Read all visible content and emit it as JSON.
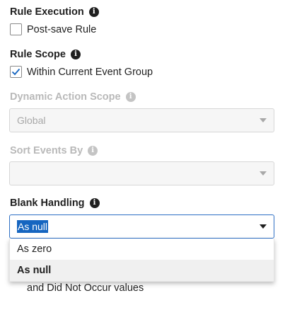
{
  "rule_execution": {
    "title": "Rule Execution",
    "post_save_label": "Post-save Rule",
    "post_save_checked": false
  },
  "rule_scope": {
    "title": "Rule Scope",
    "within_group_label": "Within Current Event Group",
    "within_group_checked": true
  },
  "dynamic_action_scope": {
    "title": "Dynamic Action Scope",
    "value": "Global",
    "disabled": true
  },
  "sort_events_by": {
    "title": "Sort Events By",
    "value": "",
    "disabled": true
  },
  "blank_handling": {
    "title": "Blank Handling",
    "selected": "As null",
    "options": [
      "As zero",
      "As null"
    ]
  },
  "partial_text": "and Did Not Occur values",
  "icons": {
    "info": "info-icon",
    "checkmark": "checkmark-icon",
    "dropdown": "chevron-down-icon"
  },
  "colors": {
    "accent": "#1565c0",
    "disabled": "#b9b9b9"
  }
}
